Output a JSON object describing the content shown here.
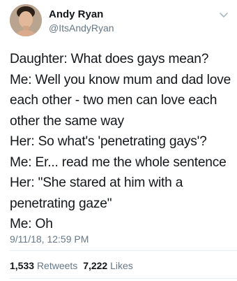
{
  "user": {
    "display_name": "Andy Ryan",
    "handle": "@ItsAndyRyan"
  },
  "tweet": {
    "lines": [
      "Daughter: What does gays mean?",
      "Me: Well you know mum and dad love",
      "each other - two men can love each",
      "other the same way",
      "Her: So what's 'penetrating gays'?",
      "Me: Er... read me the whole sentence",
      "Her: \"She stared at him with a",
      "penetrating gaze\"",
      "Me: Oh"
    ],
    "timestamp": "9/11/18, 12:59 PM"
  },
  "stats": {
    "retweets_count": "1,533",
    "retweets_label": "Retweets",
    "likes_count": "7,222",
    "likes_label": "Likes"
  },
  "icons": {
    "menu": "chevron-down-icon"
  },
  "colors": {
    "text": "#14171a",
    "secondary": "#657786",
    "divider": "#e6ecf0"
  }
}
